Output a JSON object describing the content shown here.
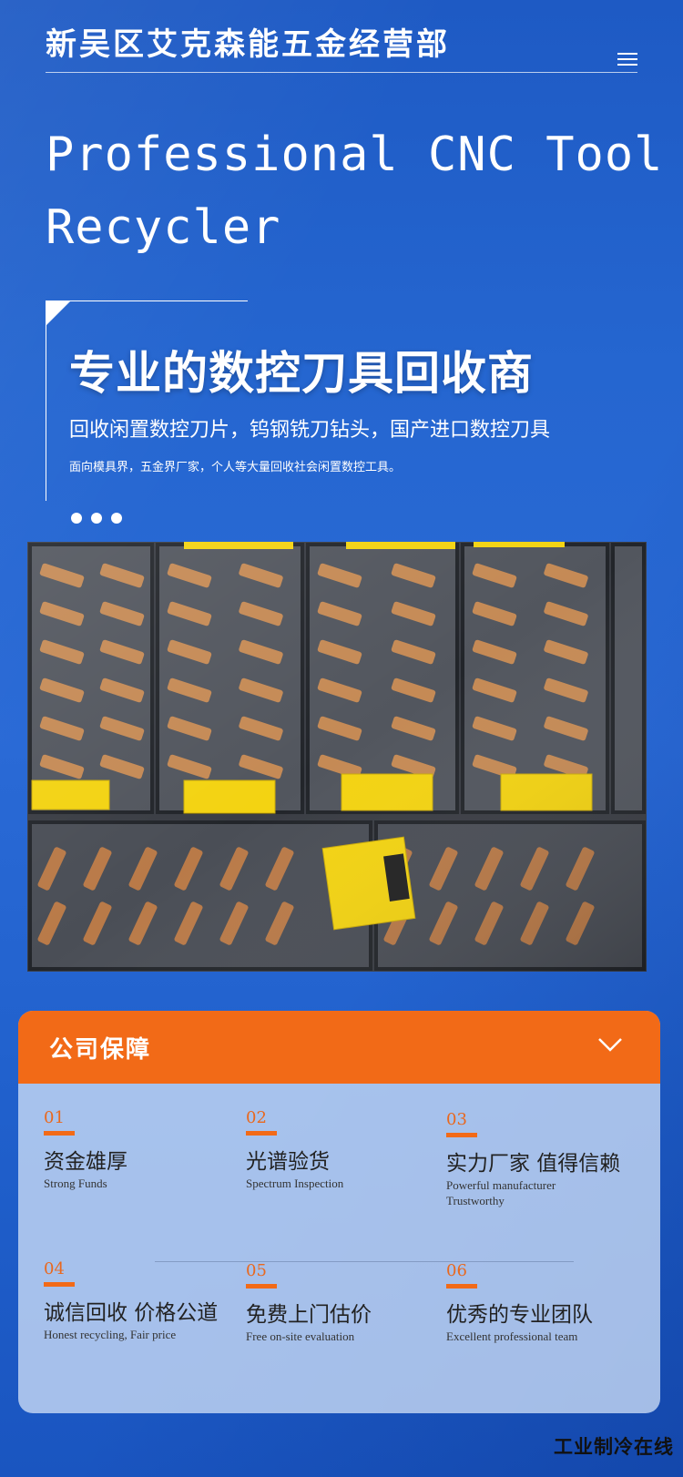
{
  "header": {
    "brand": "新吴区艾克森能五金经营部",
    "menu_icon": "hamburger-menu-icon"
  },
  "hero": {
    "line1": "Professional CNC Tool",
    "line2": "Recycler"
  },
  "slide": {
    "title": "专业的数控刀具回收商",
    "subtitle": "回收闲置数控刀片，钨钢铣刀钻头，国产进口数控刀具",
    "small": "面向模具界，五金界厂家，个人等大量回收社会闲置数控工具。",
    "dot_count": 3
  },
  "photo": {
    "subject": "boxes-of-gold-cnc-inserts-photo"
  },
  "guarantee": {
    "title": "公司保障",
    "chevron_icon": "chevron-down-icon",
    "items": [
      {
        "num": "01",
        "title": "资金雄厚",
        "sub": "Strong Funds"
      },
      {
        "num": "02",
        "title": "光谱验货",
        "sub": "Spectrum Inspection"
      },
      {
        "num": "03",
        "title": "实力厂家 值得信赖",
        "sub": "Powerful manufacturer Trustworthy"
      },
      {
        "num": "04",
        "title": "诚信回收 价格公道",
        "sub": "Honest recycling, Fair price"
      },
      {
        "num": "05",
        "title": "免费上门估价",
        "sub": "Free on-site evaluation"
      },
      {
        "num": "06",
        "title": "优秀的专业团队",
        "sub": "Excellent professional team"
      }
    ]
  },
  "footer": {
    "watermark": "工业制冷在线"
  },
  "colors": {
    "background": "#2566d0",
    "accent": "#f26a17",
    "panel": "#cddef6"
  }
}
